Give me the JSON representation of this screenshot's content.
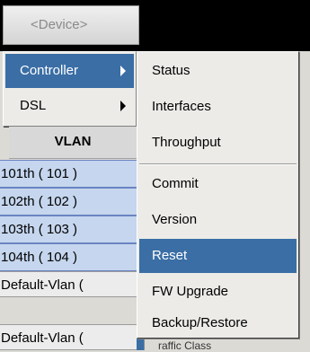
{
  "device_button": {
    "label": "<Device>"
  },
  "submenu": [
    {
      "label": "Controller",
      "has_arrow": true,
      "active": true
    },
    {
      "label": "DSL",
      "has_arrow": true,
      "active": false
    }
  ],
  "table": {
    "header": "VLAN",
    "rows": [
      {
        "label": "101th ( 101 )"
      },
      {
        "label": "102th ( 102 )"
      },
      {
        "label": "103th ( 103 )"
      },
      {
        "label": "104th ( 104 )"
      },
      {
        "label": "Default-Vlan ("
      },
      {
        "label": "Default-Vlan ("
      }
    ]
  },
  "context_menu": {
    "group1": [
      {
        "label": "Status"
      },
      {
        "label": "Interfaces"
      },
      {
        "label": "Throughput"
      }
    ],
    "group2": [
      {
        "label": "Commit"
      },
      {
        "label": "Version"
      },
      {
        "label": "Reset",
        "active": true
      },
      {
        "label": "FW Upgrade"
      },
      {
        "label": "Backup/Restore"
      }
    ]
  },
  "edge_text": "raffic Class"
}
